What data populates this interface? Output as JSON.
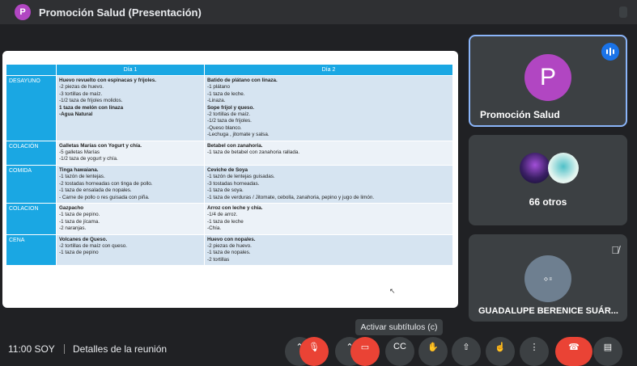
{
  "meeting": {
    "avatar_letter": "P",
    "title": "Promoción Salud (Presentación)"
  },
  "slide": {
    "headers": [
      "",
      "Día 1",
      "Día 2"
    ],
    "rows": [
      {
        "meal": "DESAYUNO",
        "day1": [
          {
            "t": "Huevo revuelto con espinacas y frijoles.",
            "b": true
          },
          {
            "t": "-2 piezas de huevo."
          },
          {
            "t": "-3 tortillas de maíz."
          },
          {
            "t": "-1/2 taza de frijoles molidos."
          },
          {
            "t": "1 taza de melón con linaza",
            "b": true
          },
          {
            "t": "-Agua Natural",
            "b": true
          }
        ],
        "day2": [
          {
            "t": "Batido de plátano con linaza.",
            "b": true
          },
          {
            "t": "-1 plátano"
          },
          {
            "t": "-1 taza de leche."
          },
          {
            "t": "-Linaza."
          },
          {
            "t": "Sope  frijol y queso.",
            "b": true
          },
          {
            "t": "-2 tortillas de maíz."
          },
          {
            "t": "-1/2 taza de frijoles."
          },
          {
            "t": "-Queso blanco."
          },
          {
            "t": "-Lechuga , jitomate y salsa."
          }
        ]
      },
      {
        "meal": "COLACIÓN",
        "day1": [
          {
            "t": "Galletas Marías con Yogurt y chía.",
            "b": true
          },
          {
            "t": "-5 galletas Marías"
          },
          {
            "t": "-1/2 taza de yogurt y chía."
          }
        ],
        "day2": [
          {
            "t": "Betabel con  zanahoria.",
            "b": true
          },
          {
            "t": "-1 taza de betabel con zanahoria rallada."
          }
        ]
      },
      {
        "meal": "COMIDA",
        "day1": [
          {
            "t": "Tinga hawaiana.",
            "b": true
          },
          {
            "t": "-1 tazón de lentejas."
          },
          {
            "t": "-2 tostadas horneadas con tinga de pollo."
          },
          {
            "t": "-1 taza de ensalada de nopales."
          },
          {
            "t": "- Carne de pollo o res  guisada con piña."
          }
        ],
        "day2": [
          {
            "t": "Ceviche de Soya",
            "b": true
          },
          {
            "t": "-1 tazón de lentejas guisadas."
          },
          {
            "t": "-3 tostadas horneadas."
          },
          {
            "t": "-1 taza de soya."
          },
          {
            "t": "-1 taza de verduras / Jitomate, cebolla, zanahoria, pepino y jugo de limón."
          }
        ]
      },
      {
        "meal": "COLACION",
        "day1": [
          {
            "t": "Gazpacho",
            "b": true
          },
          {
            "t": "-1 taza de pepino."
          },
          {
            "t": "-1 taza de jícama."
          },
          {
            "t": "-2 naranjas."
          }
        ],
        "day2": [
          {
            "t": "Arroz con leche  y chía.",
            "b": true
          },
          {
            "t": "-1/4 de arroz."
          },
          {
            "t": "-1 taza de leche"
          },
          {
            "t": "-Chía."
          }
        ]
      },
      {
        "meal": "CENA",
        "day1": [
          {
            "t": "Volcanes de Queso.",
            "b": true
          },
          {
            "t": "-2 tortillas de maíz con queso."
          },
          {
            "t": "-1 taza de pepino"
          }
        ],
        "day2": [
          {
            "t": "Huevo con nopales.",
            "b": true
          },
          {
            "t": "-2 piezas de huevo."
          },
          {
            "t": "-1 taza de nopales."
          },
          {
            "t": "-2 tortillas"
          }
        ]
      }
    ]
  },
  "participants": {
    "presenter": {
      "letter": "P",
      "name": "Promoción Salud"
    },
    "others_label": "66 otros",
    "third": {
      "name": "GUADALUPE BERENICE SUÁR..."
    }
  },
  "tooltip": "Activar subtítulos (c)",
  "bottom": {
    "time": "11:00 SOY",
    "details": "Detalles de la reunión"
  },
  "colors": {
    "accent": "#1aa7e3",
    "presenter_purple": "#b146c2",
    "end_call_red": "#ea4335",
    "active_border": "#8ab4f8"
  }
}
